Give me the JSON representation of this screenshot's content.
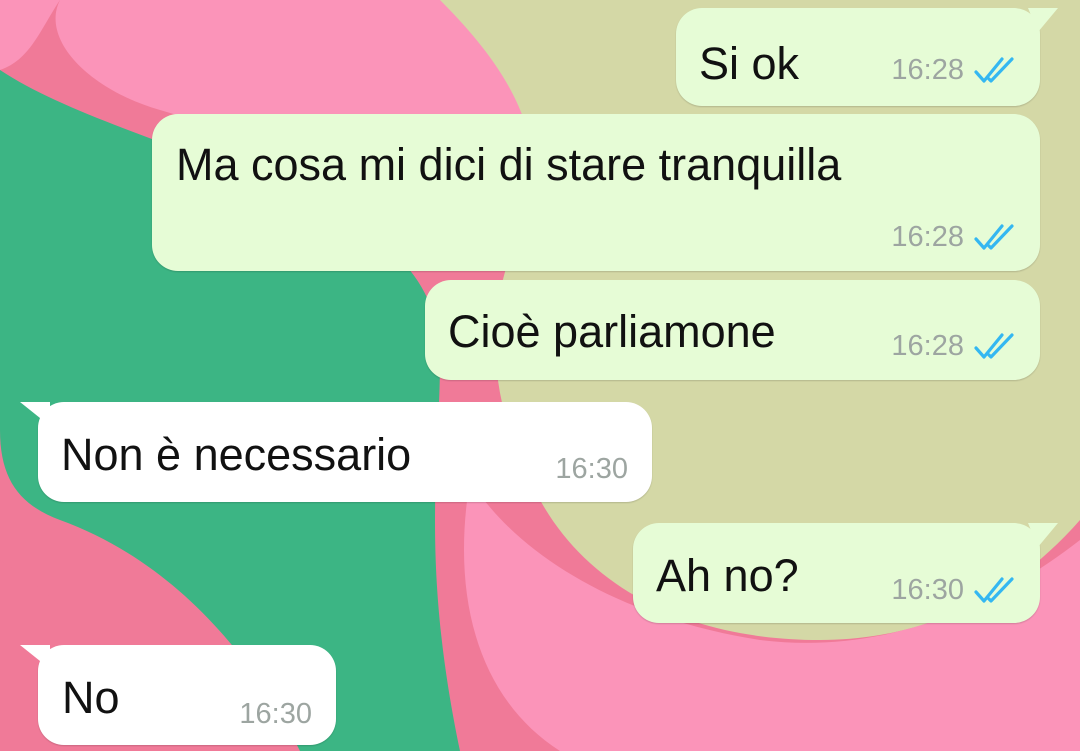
{
  "chat": {
    "messages": [
      {
        "id": "m1",
        "direction": "outgoing",
        "text": "Si ok",
        "time": "16:28",
        "status": "read"
      },
      {
        "id": "m2",
        "direction": "outgoing",
        "text": "Ma cosa mi dici di stare tranquilla",
        "time": "16:28",
        "status": "read"
      },
      {
        "id": "m3",
        "direction": "outgoing",
        "text": "Cioè parliamone",
        "time": "16:28",
        "status": "read"
      },
      {
        "id": "m4",
        "direction": "incoming",
        "text": "Non è necessario",
        "time": "16:30"
      },
      {
        "id": "m5",
        "direction": "outgoing",
        "text": "Ah no?",
        "time": "16:30",
        "status": "read"
      },
      {
        "id": "m6",
        "direction": "incoming",
        "text": "No",
        "time": "16:30"
      }
    ]
  },
  "icons": {
    "read_receipt": "double-check-icon"
  },
  "colors": {
    "outgoing_bubble": "#e6fcd6",
    "incoming_bubble": "#ffffff",
    "read_tick": "#34b7f1",
    "timestamp": "#9da5a1",
    "wallpaper_pink": "#f07a98",
    "wallpaper_light_pink": "#fb94b9",
    "wallpaper_green": "#3cb584",
    "wallpaper_olive": "#d4d8a6"
  }
}
